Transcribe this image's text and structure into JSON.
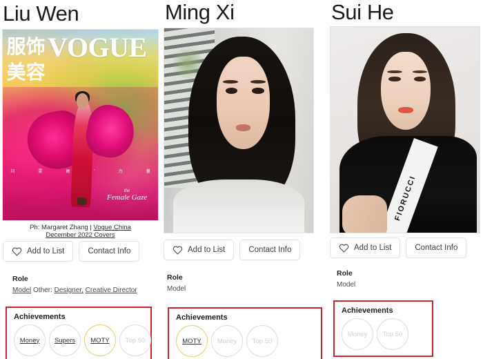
{
  "cards": [
    {
      "name": "Liu Wen",
      "photo_type": "vogue-cover",
      "cover": {
        "masthead": "VOGUE",
        "cn_top": "服饰",
        "cn_sub": "美容",
        "side_chars": [
          "刘",
          "雯",
          "她",
          "·",
          "力",
          "量"
        ],
        "gaze_line1": "the",
        "gaze_line2": "Female Gaze"
      },
      "caption": {
        "prefix": "Ph: Margaret Zhang | ",
        "link1": "Vogue China",
        "link2": "December 2022 Covers"
      },
      "buttons": {
        "add": "Add to List",
        "contact": "Contact Info"
      },
      "role": {
        "label": "Role",
        "primary": "Model",
        "other_label": "Other:",
        "others": [
          "Designer,",
          "Creative Director"
        ]
      },
      "achievements": {
        "title": "Achievements",
        "badges": [
          {
            "label": "Money",
            "state": "active"
          },
          {
            "label": "Supers",
            "state": "active"
          },
          {
            "label": "MOTY",
            "state": "gold"
          },
          {
            "label": "Top 50",
            "state": "inactive"
          }
        ]
      }
    },
    {
      "name": "Ming Xi",
      "photo_type": "portrait-blinds",
      "buttons": {
        "add": "Add to List",
        "contact": "Contact Info"
      },
      "role": {
        "label": "Role",
        "primary": "Model",
        "other_label": "",
        "others": []
      },
      "achievements": {
        "title": "Achievements",
        "badges": [
          {
            "label": "MOTY",
            "state": "gold"
          },
          {
            "label": "Money",
            "state": "inactive"
          },
          {
            "label": "Top 50",
            "state": "inactive"
          }
        ]
      }
    },
    {
      "name": "Sui He",
      "photo_type": "portrait-fiorucci",
      "photo_text": "FIORUCCI",
      "buttons": {
        "add": "Add to List",
        "contact": "Contact Info"
      },
      "role": {
        "label": "Role",
        "primary": "Model",
        "other_label": "",
        "others": []
      },
      "achievements": {
        "title": "Achievements",
        "badges": [
          {
            "label": "Money",
            "state": "inactive"
          },
          {
            "label": "Top 50",
            "state": "inactive"
          }
        ]
      }
    }
  ],
  "colors": {
    "achievement_border": "#cc2229",
    "badge_gold": "#e3d26a",
    "badge_inactive_text": "#cfcfcf",
    "text_primary": "#1b1b1b"
  },
  "icons": {
    "add_to_list": "heart-icon"
  }
}
